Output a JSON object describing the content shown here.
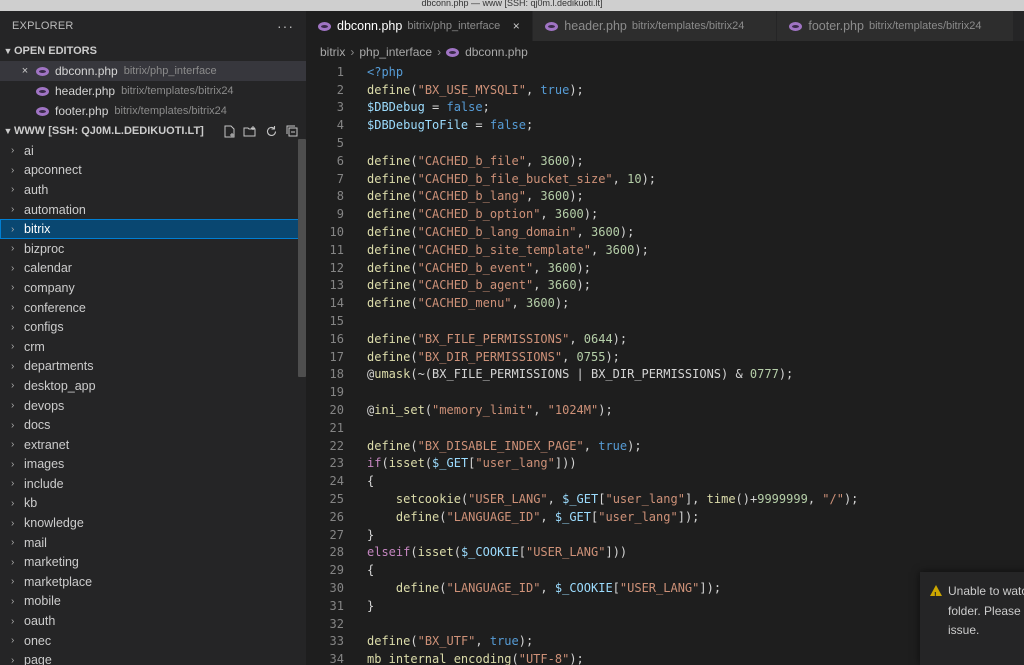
{
  "window": {
    "title": "dbconn.php — www [SSH: qj0m.l.dedikuoti.lt]"
  },
  "sidebar": {
    "header_title": "EXPLORER",
    "more_label": "···",
    "open_editors_title": "OPEN EDITORS",
    "open_editors": [
      {
        "name": "dbconn.php",
        "path": "bitrix/php_interface",
        "close": "×"
      },
      {
        "name": "header.php",
        "path": "bitrix/templates/bitrix24"
      },
      {
        "name": "footer.php",
        "path": "bitrix/templates/bitrix24"
      }
    ],
    "workspace_title": "WWW [SSH: QJ0M.L.DEDIKUOTI.LT]",
    "workspace_actions": [
      "new-file-icon",
      "new-folder-icon",
      "refresh-icon",
      "collapse-all-icon"
    ],
    "tree": [
      "ai",
      "apconnect",
      "auth",
      "automation",
      "bitrix",
      "bizproc",
      "calendar",
      "company",
      "conference",
      "configs",
      "crm",
      "departments",
      "desktop_app",
      "devops",
      "docs",
      "extranet",
      "images",
      "include",
      "kb",
      "knowledge",
      "mail",
      "marketing",
      "marketplace",
      "mobile",
      "oauth",
      "onec",
      "page"
    ],
    "selected_index": 4
  },
  "editor": {
    "tabs": [
      {
        "name": "dbconn.php",
        "path": "bitrix/php_interface",
        "active": true,
        "close": "×"
      },
      {
        "name": "header.php",
        "path": "bitrix/templates/bitrix24",
        "active": false
      },
      {
        "name": "footer.php",
        "path": "bitrix/templates/bitrix24",
        "active": false
      }
    ],
    "breadcrumb": [
      "bitrix",
      "php_interface",
      "dbconn.php"
    ],
    "line_numbers": [
      "1",
      "2",
      "3",
      "4",
      "5",
      "6",
      "7",
      "8",
      "9",
      "10",
      "11",
      "12",
      "13",
      "14",
      "15",
      "16",
      "17",
      "18",
      "19",
      "20",
      "21",
      "22",
      "23",
      "24",
      "25",
      "26",
      "27",
      "28",
      "29",
      "30",
      "31",
      "32",
      "33",
      "34"
    ],
    "code_lines": [
      "<?php",
      "define(\"BX_USE_MYSQLI\", true);",
      "$DBDebug = false;",
      "$DBDebugToFile = false;",
      "",
      "define(\"CACHED_b_file\", 3600);",
      "define(\"CACHED_b_file_bucket_size\", 10);",
      "define(\"CACHED_b_lang\", 3600);",
      "define(\"CACHED_b_option\", 3600);",
      "define(\"CACHED_b_lang_domain\", 3600);",
      "define(\"CACHED_b_site_template\", 3600);",
      "define(\"CACHED_b_event\", 3600);",
      "define(\"CACHED_b_agent\", 3660);",
      "define(\"CACHED_menu\", 3600);",
      "",
      "define(\"BX_FILE_PERMISSIONS\", 0644);",
      "define(\"BX_DIR_PERMISSIONS\", 0755);",
      "@umask(~(BX_FILE_PERMISSIONS | BX_DIR_PERMISSIONS) & 0777);",
      "",
      "@ini_set(\"memory_limit\", \"1024M\");",
      "",
      "define(\"BX_DISABLE_INDEX_PAGE\", true);",
      "if(isset($_GET[\"user_lang\"]))",
      "{",
      "    setcookie(\"USER_LANG\", $_GET[\"user_lang\"], time()+9999999, \"/\");",
      "    define(\"LANGUAGE_ID\", $_GET[\"user_lang\"]);",
      "}",
      "elseif(isset($_COOKIE[\"USER_LANG\"]))",
      "{",
      "    define(\"LANGUAGE_ID\", $_COOKIE[\"USER_LANG\"]);",
      "}",
      "",
      "define(\"BX_UTF\", true);",
      "mb_internal_encoding(\"UTF-8\");"
    ]
  },
  "notification": {
    "lines": [
      "Unable to watc",
      "folder. Please f",
      "issue."
    ],
    "icon": "warning-icon"
  },
  "colors": {
    "sidebar_bg": "#252526",
    "editor_bg": "#1e1e1e",
    "selection": "#094771",
    "php_icon": "#a074c4",
    "warning": "#cca700"
  }
}
